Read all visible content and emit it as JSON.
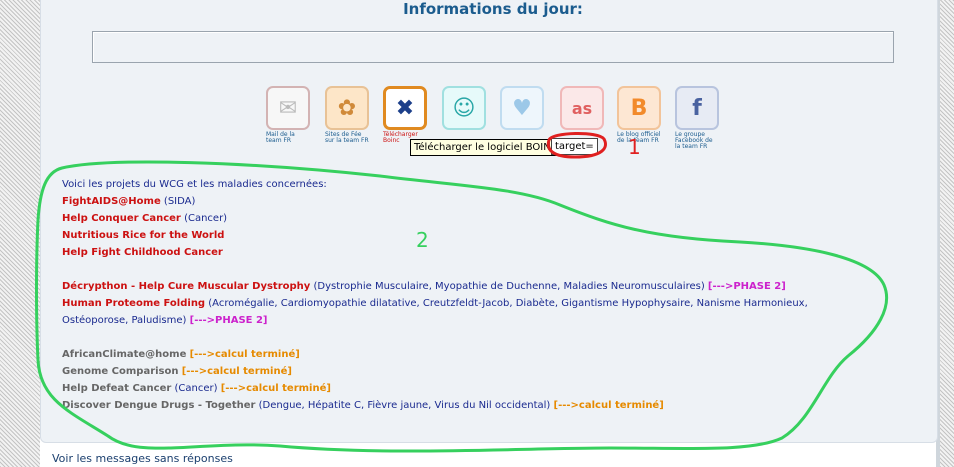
{
  "header": {
    "title": "Informations du jour:"
  },
  "info_box": {
    "value": ""
  },
  "icons": [
    {
      "name": "mail-icon",
      "glyph": "✉",
      "caption": "Mail de la team FR",
      "bg": "#f7f7f7",
      "fg": "#bbbbbb",
      "border": "#d3b3b3"
    },
    {
      "name": "sites-icon",
      "glyph": "✿",
      "caption": "Sites de Fée sur la team FR",
      "bg": "#fde6c8",
      "fg": "#d08a3a",
      "border": "#e8c296"
    },
    {
      "name": "boinc-icon",
      "glyph": "✖",
      "caption": "Télécharger Boinc",
      "bg": "#ffffff",
      "fg": "#1c3f8a",
      "border": "#e08a20"
    },
    {
      "name": "mascot-icon",
      "glyph": "☺",
      "caption": "Retrouvez la team FR",
      "bg": "#e6fafa",
      "fg": "#29a7a7",
      "border": "#a0e0e0"
    },
    {
      "name": "heart-icon",
      "glyph": "♥",
      "caption": "Le site officiel de la team FR",
      "bg": "#eef6fc",
      "fg": "#9cc8e8",
      "border": "#c0dcf0"
    },
    {
      "name": "lastfm-icon",
      "glyph": "as",
      "caption": "Last.fm",
      "bg": "#fbe8e8",
      "fg": "#e06060",
      "border": "#f0b8b8"
    },
    {
      "name": "blogger-icon",
      "glyph": "B",
      "caption": "Le blog officiel de la team FR",
      "bg": "#fde7d3",
      "fg": "#f28a2a",
      "border": "#f2c49a"
    },
    {
      "name": "facebook-icon",
      "glyph": "f",
      "caption": "Le groupe Facebook de la team FR",
      "bg": "#e7ebf4",
      "fg": "#4a62a0",
      "border": "#b8c4de"
    }
  ],
  "tooltip": {
    "text": "Télécharger le logiciel BOINC",
    "chip": "target="
  },
  "annotations": {
    "one": "1",
    "two": "2"
  },
  "projects": {
    "intro": "Voici les projets du WCG et les maladies concernées:",
    "active": [
      {
        "name": "FightAIDS@Home",
        "disease": "(SIDA)"
      },
      {
        "name": "Help Conquer Cancer",
        "disease": "(Cancer)"
      },
      {
        "name": "Nutritious Rice for the World",
        "disease": ""
      },
      {
        "name": "Help Fight Childhood Cancer",
        "disease": ""
      }
    ],
    "phase2": [
      {
        "name": "Décrypthon - Help Cure Muscular Dystrophy",
        "disease": "(Dystrophie Musculaire, Myopathie de Duchenne, Maladies Neuromusculaires)",
        "status": "[--->PHASE 2]"
      },
      {
        "name": "Human Proteome Folding",
        "disease": "(Acromégalie, Cardiomyopathie dilatative, Creutzfeldt-Jacob, Diabète, Gigantisme Hypophysaire, Nanisme Harmonieux,",
        "disease2": "Ostéoporose, Paludisme)",
        "status": "[--->PHASE 2]"
      }
    ],
    "finished": [
      {
        "name": "AfricanClimate@home",
        "disease": "",
        "status": "[--->calcul terminé]"
      },
      {
        "name": "Genome Comparison",
        "disease": "",
        "status": "[--->calcul terminé]"
      },
      {
        "name": "Help Defeat Cancer",
        "disease": "(Cancer)",
        "status": "[--->calcul terminé]"
      },
      {
        "name": "Discover Dengue Drugs - Together",
        "disease": "(Dengue, Hépatite C, Fièvre jaune, Virus du Nil occidental)",
        "status": "[--->calcul terminé]"
      }
    ]
  },
  "footer": {
    "link": "Voir les messages sans réponses"
  },
  "colors": {
    "accent": "#1b5c8e",
    "annotation_red": "#e02020",
    "annotation_green": "#36d05e",
    "phase": "#cc22cc",
    "done": "#e68a00"
  }
}
